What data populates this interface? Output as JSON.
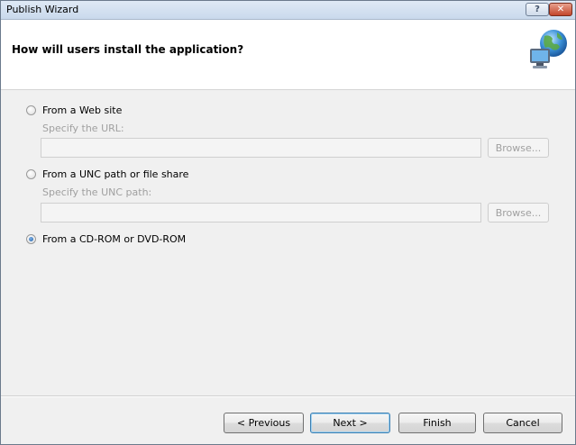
{
  "window": {
    "title": "Publish Wizard",
    "help_label": "?",
    "close_label": "✕"
  },
  "header": {
    "title": "How will users install the application?",
    "icon": "globe-computer-icon"
  },
  "options": [
    {
      "label": "From a Web site",
      "checked": false,
      "sub_label": "Specify the URL:",
      "input_value": "",
      "browse_label": "Browse..."
    },
    {
      "label": "From a UNC path or file share",
      "checked": false,
      "sub_label": "Specify the UNC path:",
      "input_value": "",
      "browse_label": "Browse..."
    },
    {
      "label": "From a CD-ROM or DVD-ROM",
      "checked": true
    }
  ],
  "buttons": {
    "previous": "< Previous",
    "next": "Next >",
    "finish": "Finish",
    "cancel": "Cancel"
  },
  "colors": {
    "disabled_text": "#a0a0a0",
    "radio_selected": "#1f5fa8"
  }
}
